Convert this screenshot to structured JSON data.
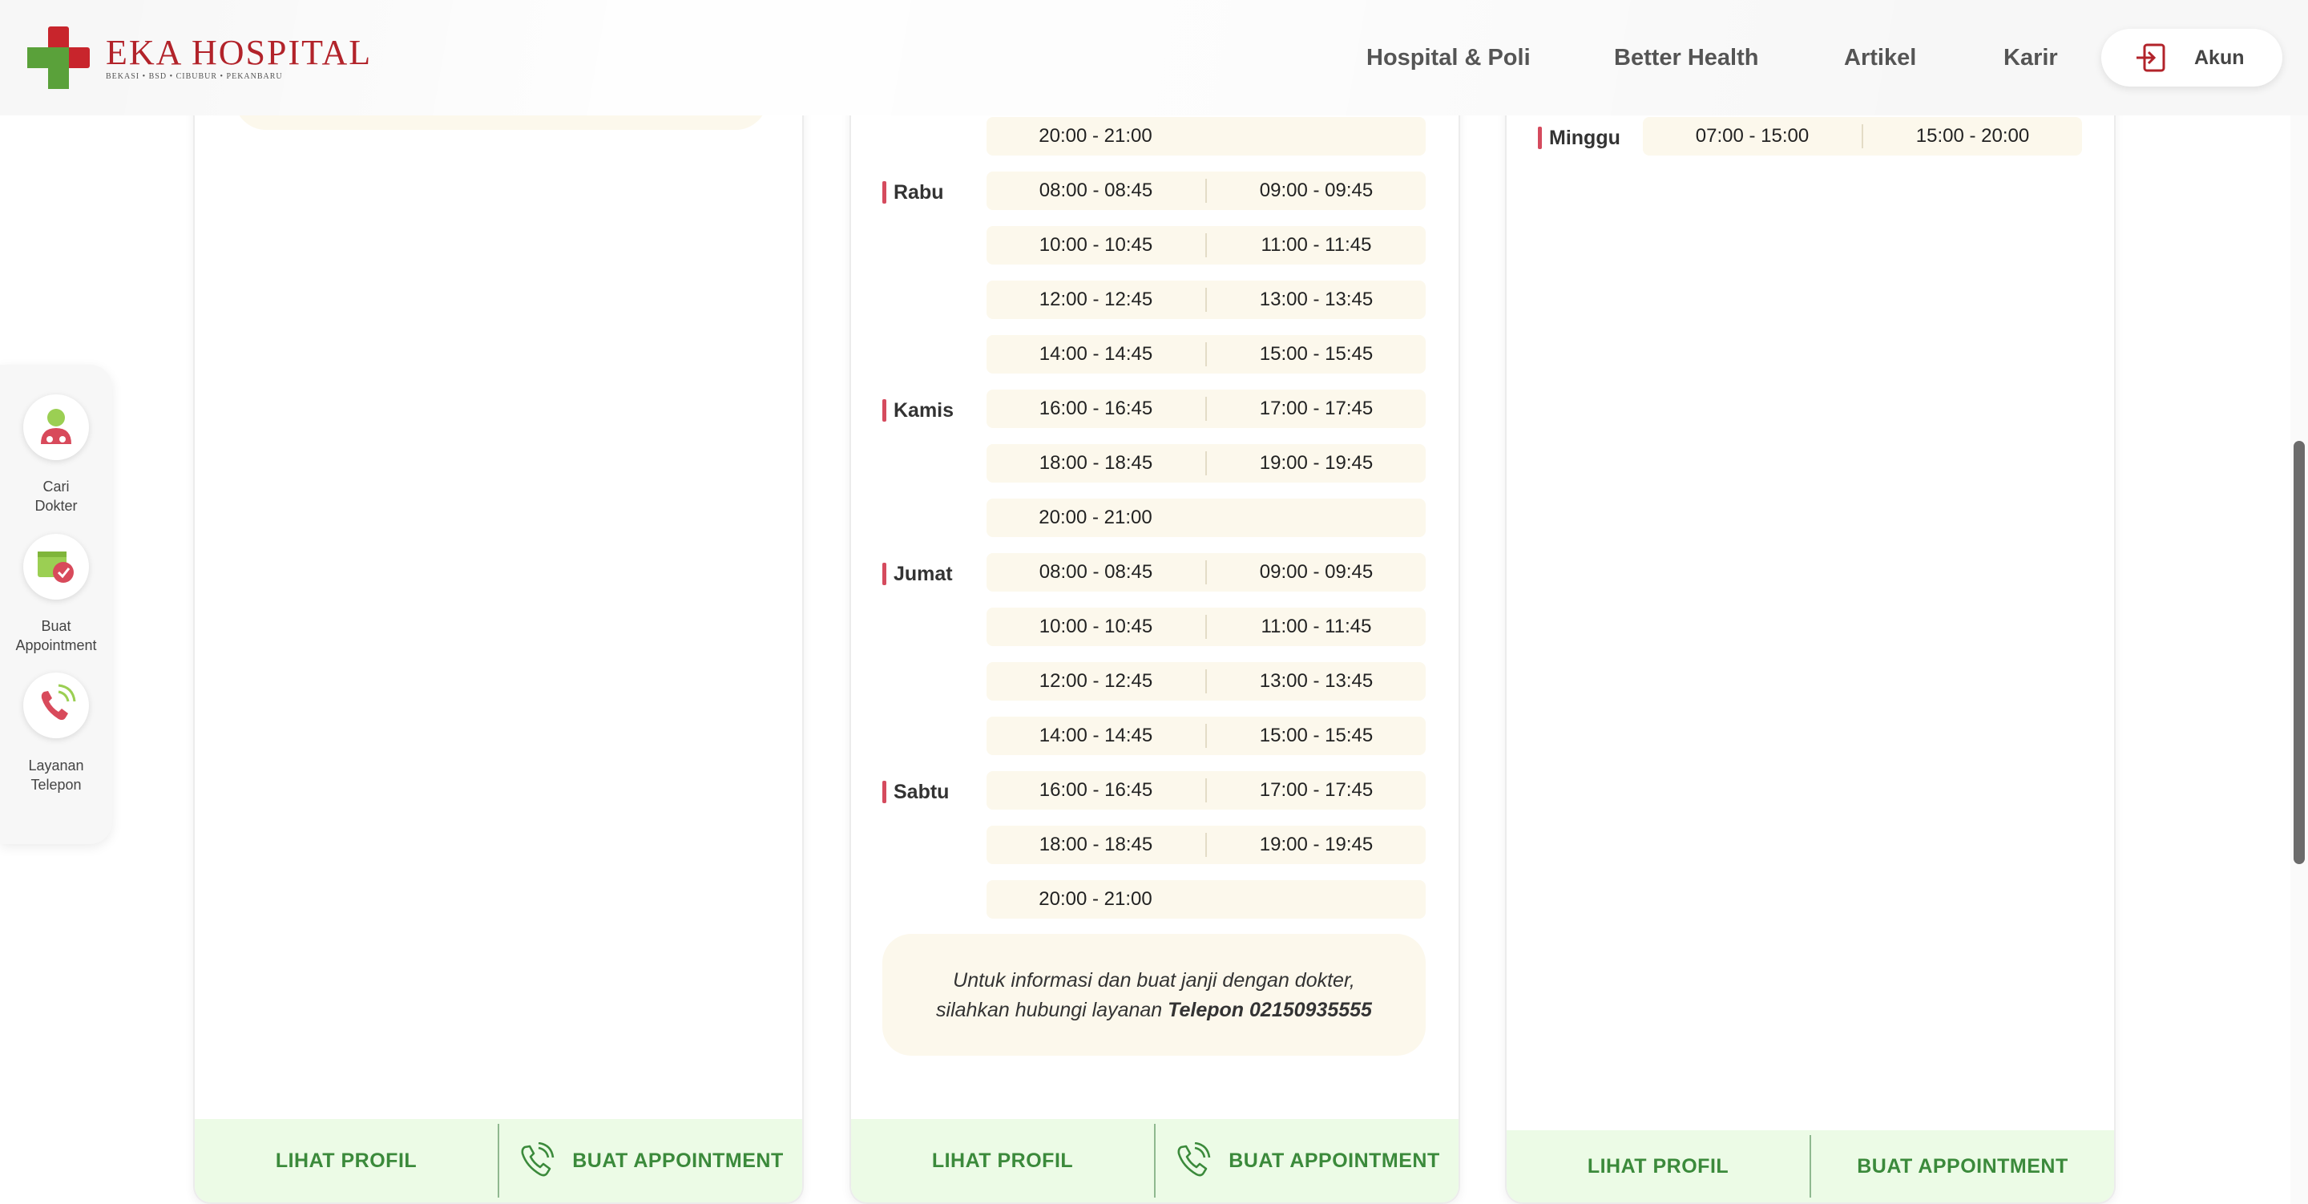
{
  "brand": {
    "name": "EKA HOSPITAL",
    "tagline": "BEKASI • BSD • CIBUBUR • PEKANBARU",
    "primary_color": "#b2232a",
    "green_color": "#3b8a3b"
  },
  "nav": {
    "items": [
      "Hospital & Poli",
      "Better Health",
      "Artikel",
      "Karir"
    ],
    "account_label": "Akun"
  },
  "side_menu": {
    "items": [
      {
        "label_line1": "Cari",
        "label_line2": "Dokter",
        "icon": "doctor-icon"
      },
      {
        "label_line1": "Buat",
        "label_line2": "Appointment",
        "icon": "calendar-check-icon"
      },
      {
        "label_line1": "Layanan",
        "label_line2": "Telepon",
        "icon": "phone-icon"
      }
    ]
  },
  "card2": {
    "first_slot": "20:00 - 21:00",
    "days": {
      "rabu": {
        "label": "Rabu",
        "rows": [
          [
            "08:00 - 08:45",
            "09:00 - 09:45"
          ],
          [
            "10:00 - 10:45",
            "11:00 - 11:45"
          ],
          [
            "12:00 - 12:45",
            "13:00 - 13:45"
          ],
          [
            "14:00 - 14:45",
            "15:00 - 15:45"
          ]
        ]
      },
      "kamis": {
        "label": "Kamis",
        "rows": [
          [
            "16:00 - 16:45",
            "17:00 - 17:45"
          ],
          [
            "18:00 - 18:45",
            "19:00 - 19:45"
          ],
          [
            "20:00 - 21:00"
          ]
        ]
      },
      "jumat": {
        "label": "Jumat",
        "rows": [
          [
            "08:00 - 08:45",
            "09:00 - 09:45"
          ],
          [
            "10:00 - 10:45",
            "11:00 - 11:45"
          ],
          [
            "12:00 - 12:45",
            "13:00 - 13:45"
          ],
          [
            "14:00 - 14:45",
            "15:00 - 15:45"
          ]
        ]
      },
      "sabtu": {
        "label": "Sabtu",
        "rows": [
          [
            "16:00 - 16:45",
            "17:00 - 17:45"
          ],
          [
            "18:00 - 18:45",
            "19:00 - 19:45"
          ],
          [
            "20:00 - 21:00"
          ]
        ]
      }
    },
    "info_text": "Untuk informasi dan buat janji dengan dokter, silahkan hubungi layanan",
    "info_phone": "Telepon 02150935555"
  },
  "card3": {
    "day_label": "Minggu",
    "slots": [
      "07:00 - 15:00",
      "15:00 - 20:00"
    ]
  },
  "buttons": {
    "profile": "LIHAT PROFIL",
    "appointment": "BUAT APPOINTMENT"
  }
}
